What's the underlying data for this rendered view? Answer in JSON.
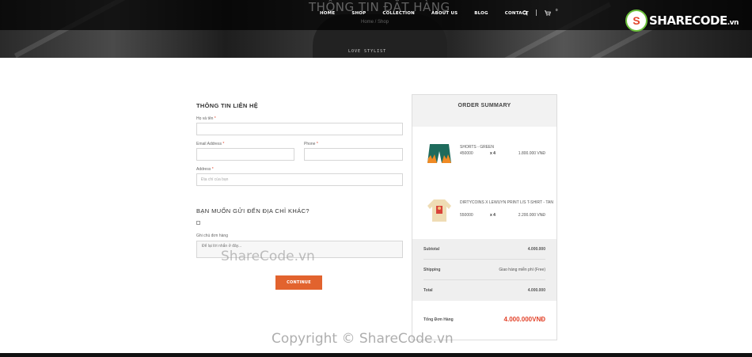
{
  "hero": {
    "title": "THÔNG TIN ĐẶT HÀNG",
    "breadcrumb": "Home / Shop",
    "shirt_print": "LOVE STYLIST"
  },
  "nav": {
    "items": [
      "HOME",
      "SHOP",
      "COLLECTION",
      "ABOUT US",
      "BLOG",
      "CONTACT"
    ],
    "search_icon": "search-icon",
    "cart_icon": "cart-icon",
    "cart_count": "0"
  },
  "logo": {
    "mark": "S",
    "name": "SHARECODE",
    "suffix": ".vn"
  },
  "form": {
    "title": "THÔNG TIN LIÊN HỆ",
    "name_label": "Họ và tên",
    "email_label": "Email Address",
    "phone_label": "Phone",
    "address_label": "Address",
    "address_placeholder": "Địa chỉ của bạn",
    "required_mark": "*",
    "alt_address_heading": "BẠN MUỐN GỬI ĐẾN ĐỊA CHỈ KHÁC?",
    "notes_label": "Ghi chú đơn hàng",
    "notes_placeholder": "Để lại lời nhắn ở đây...",
    "submit_label": "CONTINUE"
  },
  "summary": {
    "title": "ORDER SUMMARY",
    "items": [
      {
        "name": "SHORTS - GREEN",
        "price": "450000",
        "qty": "x 4",
        "total": "1.800.000 VNĐ"
      },
      {
        "name": "DIRTYCOINS X LEWUYN PRINT L/S T-SHIRT - TAN",
        "price": "550000",
        "qty": "x 4",
        "total": "2.200.000 VNĐ"
      }
    ],
    "subtotal_label": "Subtotal",
    "subtotal_value": "4.000.000",
    "shipping_label": "Shipping",
    "shipping_value": "Giao hàng miễn phí (Free)",
    "total_label": "Total",
    "total_value": "4.000.000",
    "grand_label": "Tổng Đơn Hàng",
    "grand_value": "4.000.000VNĐ"
  },
  "watermarks": {
    "center": "ShareCode.vn",
    "footer": "Copyright © ShareCode.vn"
  },
  "colors": {
    "accent": "#e2632e",
    "grand_total": "#e2432a",
    "logo_ring": "#6bbf3a"
  }
}
